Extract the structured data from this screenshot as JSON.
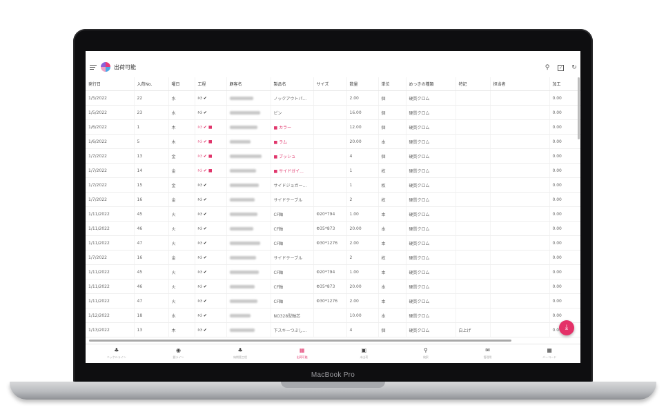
{
  "device": {
    "brand_label": "MacBook Pro"
  },
  "app": {
    "title": "出荷可能",
    "menu_icon": "menu-icon",
    "logo": "app-logo"
  },
  "toolbar": {
    "icons": [
      "search-icon",
      "checkbox-icon",
      "refresh-icon"
    ]
  },
  "table": {
    "columns": [
      "発行日",
      "入荷No.",
      "曜日",
      "工程",
      "顧客名",
      "製品名",
      "サイズ",
      "数量",
      "単位",
      "めっきの種類",
      "特記",
      "担当者",
      "加工"
    ],
    "rows": [
      {
        "date": "1/5/2022",
        "no": "22",
        "day": "水",
        "product": "ノックアウトパ...",
        "size": "",
        "qty": "2.00",
        "unit": "個",
        "plating": "硬質クロム",
        "note": "",
        "amount": "0.00",
        "chat": false
      },
      {
        "date": "1/5/2022",
        "no": "23",
        "day": "水",
        "product": "ピン",
        "size": "",
        "qty": "16.00",
        "unit": "個",
        "plating": "硬質クロム",
        "note": "",
        "amount": "0.00",
        "chat": false
      },
      {
        "date": "1/6/2022",
        "no": "1",
        "day": "木",
        "product": "カラー",
        "size": "",
        "qty": "12.00",
        "unit": "個",
        "plating": "硬質クロム",
        "note": "",
        "amount": "0.00",
        "chat": true
      },
      {
        "date": "1/6/2022",
        "no": "5",
        "day": "木",
        "product": "ラム",
        "size": "",
        "qty": "20.00",
        "unit": "本",
        "plating": "硬質クロム",
        "note": "",
        "amount": "0.00",
        "chat": true
      },
      {
        "date": "1/7/2022",
        "no": "13",
        "day": "金",
        "product": "ブッシュ",
        "size": "",
        "qty": "4",
        "unit": "個",
        "plating": "硬質クロム",
        "note": "",
        "amount": "0.00",
        "chat": true
      },
      {
        "date": "1/7/2022",
        "no": "14",
        "day": "金",
        "product": "サイドガイ...",
        "size": "",
        "qty": "1",
        "unit": "枚",
        "plating": "硬質クロム",
        "note": "",
        "amount": "0.00",
        "chat": true
      },
      {
        "date": "1/7/2022",
        "no": "15",
        "day": "金",
        "product": "サイドジョガー...",
        "size": "",
        "qty": "1",
        "unit": "枚",
        "plating": "硬質クロム",
        "note": "",
        "amount": "0.00",
        "chat": false
      },
      {
        "date": "1/7/2022",
        "no": "16",
        "day": "金",
        "product": "サイドテーブル",
        "size": "",
        "qty": "2",
        "unit": "枚",
        "plating": "硬質クロム",
        "note": "",
        "amount": "0.00",
        "chat": false
      },
      {
        "date": "1/11/2022",
        "no": "45",
        "day": "火",
        "product": "CF軸",
        "size": "Φ20*794",
        "qty": "1.00",
        "unit": "本",
        "plating": "硬質クロム",
        "note": "",
        "amount": "0.00",
        "chat": false
      },
      {
        "date": "1/11/2022",
        "no": "46",
        "day": "火",
        "product": "CF軸",
        "size": "Φ35*873",
        "qty": "20.00",
        "unit": "本",
        "plating": "硬質クロム",
        "note": "",
        "amount": "0.00",
        "chat": false
      },
      {
        "date": "1/11/2022",
        "no": "47",
        "day": "火",
        "product": "CF軸",
        "size": "Φ30*1276",
        "qty": "2.00",
        "unit": "本",
        "plating": "硬質クロム",
        "note": "",
        "amount": "0.00",
        "chat": false
      },
      {
        "date": "1/7/2022",
        "no": "16",
        "day": "金",
        "product": "サイドテーブル",
        "size": "",
        "qty": "2",
        "unit": "枚",
        "plating": "硬質クロム",
        "note": "",
        "amount": "0.00",
        "chat": false
      },
      {
        "date": "1/11/2022",
        "no": "45",
        "day": "火",
        "product": "CF軸",
        "size": "Φ20*794",
        "qty": "1.00",
        "unit": "本",
        "plating": "硬質クロム",
        "note": "",
        "amount": "0.00",
        "chat": false
      },
      {
        "date": "1/11/2022",
        "no": "46",
        "day": "火",
        "product": "CF軸",
        "size": "Φ35*873",
        "qty": "20.00",
        "unit": "本",
        "plating": "硬質クロム",
        "note": "",
        "amount": "0.00",
        "chat": false
      },
      {
        "date": "1/11/2022",
        "no": "47",
        "day": "火",
        "product": "CF軸",
        "size": "Φ30*1276",
        "qty": "2.00",
        "unit": "本",
        "plating": "硬質クロム",
        "note": "",
        "amount": "0.00",
        "chat": false
      },
      {
        "date": "1/12/2022",
        "no": "18",
        "day": "水",
        "product": "NO328型軸芯",
        "size": "",
        "qty": "10.00",
        "unit": "本",
        "plating": "硬質クロム",
        "note": "",
        "amount": "0.00",
        "chat": false
      },
      {
        "date": "1/13/2022",
        "no": "13",
        "day": "木",
        "product": "下スキーつぶし...",
        "size": "",
        "qty": "4",
        "unit": "個",
        "plating": "硬質クロム",
        "note": "白上げ",
        "amount": "0.00",
        "chat": false
      }
    ]
  },
  "fab": {
    "icon": "download-icon"
  },
  "bottom_nav": [
    {
      "icon": "nav-icon-1",
      "label": "ニッケルライン",
      "active": false
    },
    {
      "icon": "nav-icon-2",
      "label": "銀ライン",
      "active": false
    },
    {
      "icon": "nav-icon-3",
      "label": "納期管工程",
      "active": false
    },
    {
      "icon": "nav-icon-4",
      "label": "出荷可能",
      "active": true
    },
    {
      "icon": "nav-icon-5",
      "label": "未出荷",
      "active": false
    },
    {
      "icon": "nav-icon-6",
      "label": "検索",
      "active": false
    },
    {
      "icon": "nav-icon-7",
      "label": "管理用",
      "active": false
    },
    {
      "icon": "nav-icon-8",
      "label": "バーコード",
      "active": false
    }
  ],
  "colors": {
    "accent": "#e0356b",
    "bezel": "#0e0e10"
  }
}
